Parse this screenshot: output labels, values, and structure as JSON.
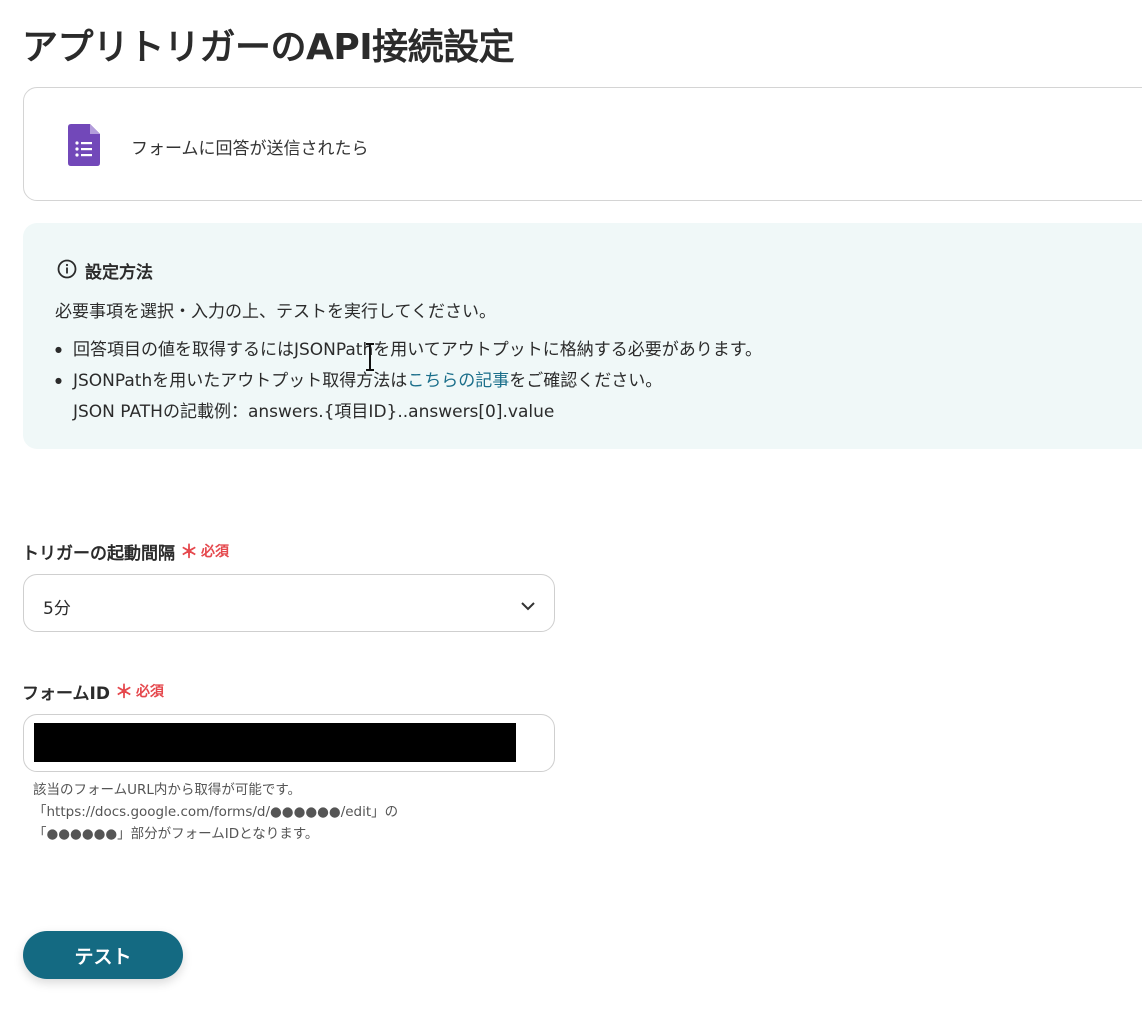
{
  "page": {
    "title": "アプリトリガーのAPI接続設定"
  },
  "app_card": {
    "icon": "google-forms-icon",
    "label": "フォームに回答が送信されたら"
  },
  "info": {
    "icon": "info-icon",
    "title": "設定方法",
    "intro": "必要事項を選択・入力の上、テストを実行してください。",
    "item1": "回答項目の値を取得するにはJSONPathを用いてアウトプットに格納する必要があります。",
    "item2_before": "JSONPathを用いたアウトプット取得方法は",
    "item2_link": "こちらの記事",
    "item2_after": "をご確認ください。",
    "item2_example": "JSON PATHの記載例：answers.{項目ID}..answers[0].value"
  },
  "trigger_interval": {
    "label": "トリガーの起動間隔",
    "required_mark": "＊",
    "required_text": "必須",
    "selected": "5分"
  },
  "form_id": {
    "label": "フォームID",
    "required_mark": "＊",
    "required_text": "必須",
    "help_line1": "該当のフォームURL内から取得が可能です。",
    "help_line2": "「https://docs.google.com/forms/d/●●●●●●/edit」の",
    "help_line3": "「●●●●●●」部分がフォームIDとなります。"
  },
  "actions": {
    "test_label": "テスト"
  },
  "colors": {
    "primary": "#146a82",
    "link": "#1a6e8a",
    "required": "#e5484d",
    "info_bg": "#f0f8f8",
    "forms_purple": "#7248b9"
  }
}
